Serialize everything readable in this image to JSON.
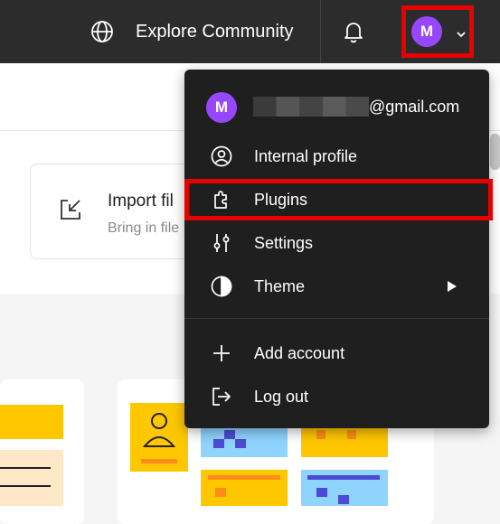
{
  "topbar": {
    "explore_label": "Explore Community",
    "globe_icon": "globe-icon",
    "bell_icon": "bell-icon",
    "avatar_letter": "M",
    "avatar_color": "#9747ff"
  },
  "import_card": {
    "title": "Import fil",
    "subtitle": "Bring in file"
  },
  "menu": {
    "account": {
      "avatar_letter": "M",
      "email_suffix": "@gmail.com"
    },
    "items": [
      {
        "label": "Internal profile",
        "icon": "user-circle-icon"
      },
      {
        "label": "Plugins",
        "icon": "plugin-icon"
      },
      {
        "label": "Settings",
        "icon": "sliders-icon"
      },
      {
        "label": "Theme",
        "icon": "half-circle-icon",
        "has_submenu": true
      },
      {
        "label": "Add account",
        "icon": "plus-icon"
      },
      {
        "label": "Log out",
        "icon": "logout-icon"
      }
    ]
  },
  "colors": {
    "highlight": "#e60000",
    "topbar_bg": "#2c2c2c",
    "menu_bg": "#1f1f1f"
  }
}
